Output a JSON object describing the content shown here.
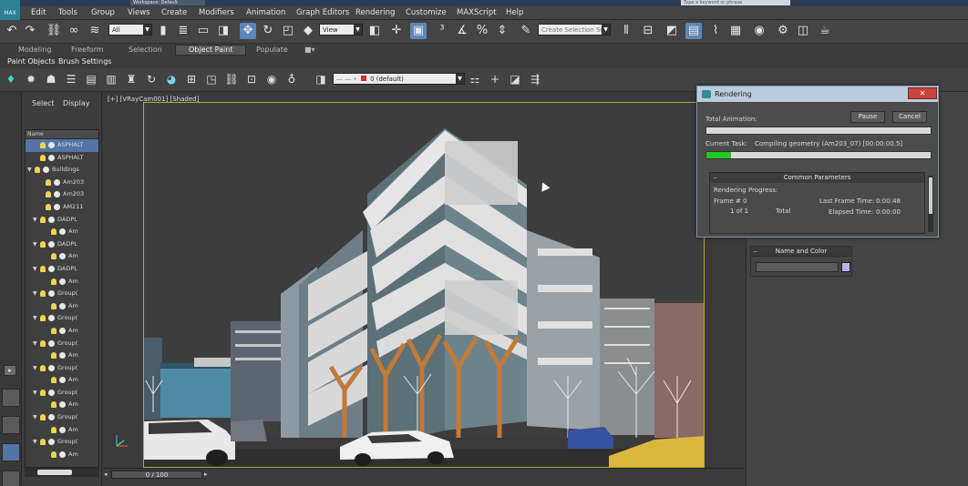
{
  "title": {
    "workspace_label": "Workspace: Default",
    "search_placeholder": "Type a keyword or phrase"
  },
  "menu": [
    "Edit",
    "Tools",
    "Group",
    "Views",
    "Create",
    "Modifiers",
    "Animation",
    "Graph Editors",
    "Rendering",
    "Customize",
    "MAXScript",
    "Help"
  ],
  "logo": "MAX",
  "toolbar": {
    "selection_filter": "All",
    "ref_coord": "View",
    "named_selection_placeholder": "Create Selection Se"
  },
  "ribbon": {
    "tabs": [
      "Modeling",
      "Freeform",
      "Selection",
      "Object Paint",
      "Populate"
    ],
    "active_tab": "Object Paint",
    "subtabs": [
      "Paint Objects",
      "Brush Settings"
    ]
  },
  "layer": {
    "layer_name": "0 (default)"
  },
  "explorer": {
    "tabs": [
      "Select",
      "Display"
    ],
    "column_header": "Name",
    "rows": [
      {
        "label": "ASPHALT",
        "indent": 1,
        "expand": "",
        "type": "obj",
        "selected": true
      },
      {
        "label": "ASPHALT",
        "indent": 1,
        "expand": "",
        "type": "obj",
        "selected": false
      },
      {
        "label": "Buildings",
        "indent": 0,
        "expand": "▼",
        "type": "group",
        "selected": false
      },
      {
        "label": "Am203",
        "indent": 2,
        "expand": "",
        "type": "obj",
        "selected": false
      },
      {
        "label": "Am203",
        "indent": 2,
        "expand": "",
        "type": "obj",
        "selected": false
      },
      {
        "label": "AM211",
        "indent": 2,
        "expand": "",
        "type": "obj",
        "selected": false
      },
      {
        "label": "DADPL",
        "indent": 1,
        "expand": "▼",
        "type": "group",
        "selected": false
      },
      {
        "label": "Am",
        "indent": 3,
        "expand": "",
        "type": "obj",
        "selected": false
      },
      {
        "label": "DADPL",
        "indent": 1,
        "expand": "▼",
        "type": "group",
        "selected": false
      },
      {
        "label": "Am",
        "indent": 3,
        "expand": "",
        "type": "obj",
        "selected": false
      },
      {
        "label": "DADPL",
        "indent": 1,
        "expand": "▼",
        "type": "group",
        "selected": false
      },
      {
        "label": "Am",
        "indent": 3,
        "expand": "",
        "type": "obj",
        "selected": false
      },
      {
        "label": "Group(",
        "indent": 1,
        "expand": "▼",
        "type": "group",
        "selected": false
      },
      {
        "label": "Am",
        "indent": 3,
        "expand": "",
        "type": "obj",
        "selected": false
      },
      {
        "label": "Group(",
        "indent": 1,
        "expand": "▼",
        "type": "group",
        "selected": false
      },
      {
        "label": "Am",
        "indent": 3,
        "expand": "",
        "type": "obj",
        "selected": false
      },
      {
        "label": "Group(",
        "indent": 1,
        "expand": "▼",
        "type": "group",
        "selected": false
      },
      {
        "label": "Am",
        "indent": 3,
        "expand": "",
        "type": "obj",
        "selected": false
      },
      {
        "label": "Group(",
        "indent": 1,
        "expand": "▼",
        "type": "group",
        "selected": false
      },
      {
        "label": "Am",
        "indent": 3,
        "expand": "",
        "type": "obj",
        "selected": false
      },
      {
        "label": "Group(",
        "indent": 1,
        "expand": "▼",
        "type": "group",
        "selected": false
      },
      {
        "label": "Am",
        "indent": 3,
        "expand": "",
        "type": "obj",
        "selected": false
      },
      {
        "label": "Group(",
        "indent": 1,
        "expand": "▼",
        "type": "group",
        "selected": false
      },
      {
        "label": "Am",
        "indent": 3,
        "expand": "",
        "type": "obj",
        "selected": false
      },
      {
        "label": "Group(",
        "indent": 1,
        "expand": "▼",
        "type": "group",
        "selected": false
      },
      {
        "label": "Am",
        "indent": 3,
        "expand": "",
        "type": "obj",
        "selected": false
      }
    ]
  },
  "viewport": {
    "label": "[+] [VRayCam001] [Shaded]"
  },
  "command_panel": {
    "rollout_title": "Name and Color",
    "object_color": "#b7b2e8"
  },
  "render_dialog": {
    "title": "Rendering",
    "close_label": "✕",
    "total_animation_label": "Total Animation:",
    "pause_label": "Pause",
    "cancel_label": "Cancel",
    "total_progress": 0.0,
    "current_task_label": "Current Task:",
    "current_task": "Compiling geometry (Am203_07) [00:00:00.5]",
    "task_progress": 0.11,
    "common_params_title": "Common Parameters",
    "rendering_progress_label": "Rendering Progress:",
    "frame_label": "Frame #",
    "frame_value": "0",
    "of_label": "1 of 1",
    "total_label": "Total",
    "last_frame_label": "Last Frame Time:",
    "last_frame_value": "0:00:48",
    "elapsed_label": "Elapsed Time:",
    "elapsed_value": "0:00:00"
  },
  "timeline": {
    "frame_display": "0 / 100"
  },
  "colors": {
    "accent": "#5b87b8",
    "viewport_border": "#b9a532",
    "progress": "#1fc71f",
    "selection": "#5474a5"
  }
}
